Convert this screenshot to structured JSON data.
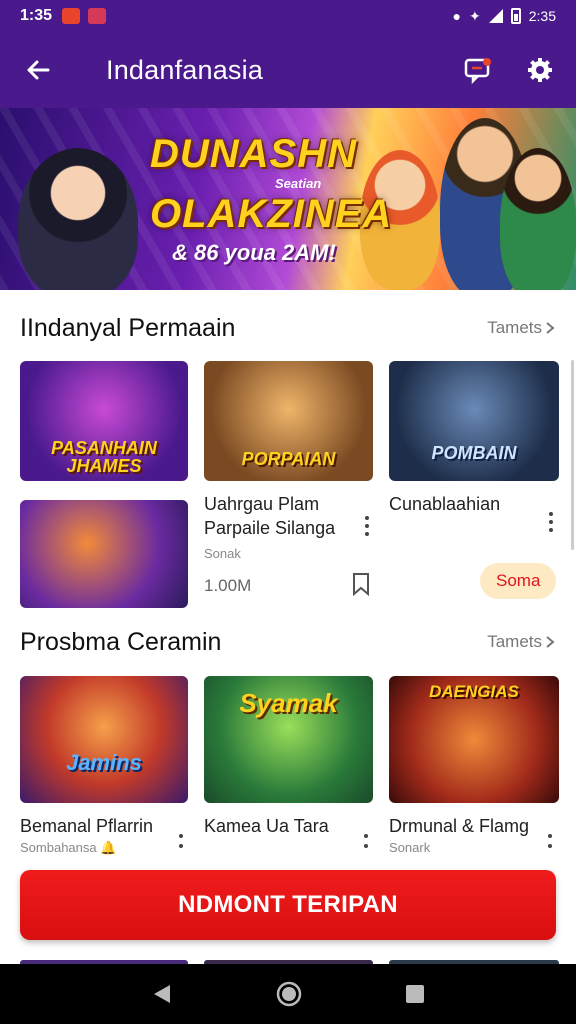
{
  "status_bar": {
    "time": "1:35",
    "battery_time": "2:35"
  },
  "app_bar": {
    "title": "Indanfanasia"
  },
  "banner": {
    "headline_1": "DUNASHN",
    "subline": "Seatian",
    "headline_2": "OLAKZINEA",
    "tagline": "& 86 youa 2AM!"
  },
  "section_1": {
    "title": "IIndanyal Permaain",
    "more_label": "Tamets",
    "tiles": [
      {
        "logo": "PASANHAIN JHAMES"
      },
      {
        "logo": "PORPAIAN"
      },
      {
        "logo": "POMBAIN"
      },
      {
        "logo": ""
      }
    ],
    "item_a": {
      "line1": "Uahrgau Plam",
      "line2": "Parpaile Silanga",
      "sub": "Sonak",
      "price": "1.00M"
    },
    "item_b": {
      "title": "Cunablaahian",
      "chip": "Soma"
    }
  },
  "section_2": {
    "title": "Prosbma Ceramin",
    "more_label": "Tamets",
    "tiles": [
      {
        "logo": "Jamins",
        "title": "Bemanal Pflarrin",
        "sub": "Sombahansa 🔔"
      },
      {
        "logo": "Syamak",
        "title": "Kamea Ua Tara",
        "sub": ""
      },
      {
        "logo": "DAENGIAS",
        "title": "Drmunal & Flamg",
        "sub": "Sonark"
      }
    ]
  },
  "cta": {
    "label": "NDMONT TERIPAN"
  },
  "colors": {
    "primary": "#4a1a8c",
    "cta": "#e0151d",
    "chip_bg": "#fde9c4"
  }
}
